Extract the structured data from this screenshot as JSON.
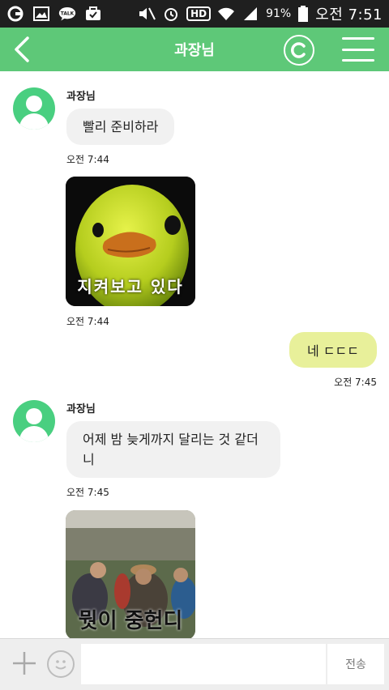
{
  "statusbar": {
    "battery": "91%",
    "time": "오전 7:51",
    "left_icons": [
      "app-icon",
      "image-icon",
      "talk-icon",
      "briefcase-icon"
    ],
    "right_icons": [
      "mute-icon",
      "alarm-icon",
      "hd-icon",
      "wifi-icon",
      "signal-icon",
      "battery-icon"
    ],
    "hd_label": "HD",
    "talk_label": "TALK"
  },
  "header": {
    "title": "과장님",
    "accent": "#5ec878"
  },
  "messages": [
    {
      "type": "text",
      "direction": "in",
      "sender": "과장님",
      "text": "빨리 준비하라",
      "time": "오전 7:44"
    },
    {
      "type": "image",
      "direction": "in",
      "caption": "지켜보고 있다",
      "time": "오전 7:44"
    },
    {
      "type": "text",
      "direction": "out",
      "text": "네 ㄷㄷㄷ",
      "time": "오전 7:45"
    },
    {
      "type": "text",
      "direction": "in",
      "sender": "과장님",
      "text": "어제 밤 늦게까지 달리는 것 같더니",
      "time": "오전 7:45"
    },
    {
      "type": "image",
      "direction": "in",
      "caption": "뭣이 중헌디"
    }
  ],
  "input": {
    "placeholder": "",
    "send_label": "전송"
  },
  "colors": {
    "incoming_bubble": "#f1f1f1",
    "outgoing_bubble": "#e8f09a",
    "avatar": "#49cf80"
  }
}
